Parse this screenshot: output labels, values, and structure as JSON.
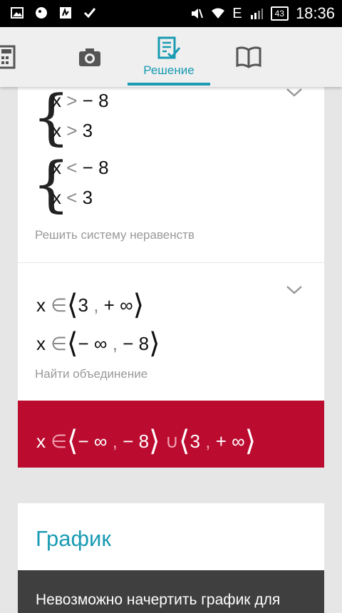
{
  "status_bar": {
    "battery": "43",
    "time": "18:36",
    "network": "E"
  },
  "tabs": [
    {
      "icon": "calculator-icon",
      "label": ""
    },
    {
      "icon": "camera-icon",
      "label": ""
    },
    {
      "icon": "solution-icon",
      "label": "Решение"
    },
    {
      "icon": "book-icon",
      "label": ""
    }
  ],
  "steps": [
    {
      "systems": [
        [
          {
            "var": "x",
            "op": ">",
            "val": "− 8"
          },
          {
            "var": "x",
            "op": ">",
            "val": "3"
          }
        ],
        [
          {
            "var": "x",
            "op": "<",
            "val": "− 8"
          },
          {
            "var": "x",
            "op": "<",
            "val": "3"
          }
        ]
      ],
      "caption": "Решить систему неравенств"
    },
    {
      "lines": [
        {
          "var": "x",
          "op": "∈",
          "left": "3",
          "sep": ",",
          "right": "+ ∞"
        },
        {
          "var": "x",
          "op": "∈",
          "left": "− ∞",
          "sep": ",",
          "right": "− 8"
        }
      ],
      "caption": "Найти объединение"
    }
  ],
  "result": {
    "var": "x",
    "op": "∈",
    "part1": {
      "left": "− ∞",
      "sep": ",",
      "right": "− 8"
    },
    "union": "∪",
    "part2": {
      "left": "3",
      "sep": ",",
      "right": "+ ∞"
    }
  },
  "graph": {
    "title": "График",
    "message": "Невозможно начертить график для"
  },
  "colors": {
    "accent": "#1a9bb3",
    "result_bg": "#bb0c30",
    "bg": "#e6e6e6"
  }
}
